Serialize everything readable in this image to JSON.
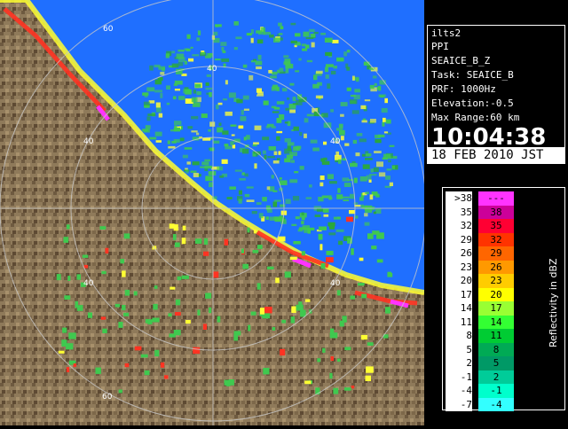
{
  "radar": {
    "range_labels": [
      "60",
      "40",
      "40",
      "40",
      "40",
      "40",
      "60"
    ],
    "colors": {
      "sea": "#1f6fff",
      "land": "#8f7a5a",
      "land_dark": "#5e4a33",
      "echo_weak": "#3fc94f",
      "echo_mid": "#2aa83a",
      "echo_strong": "#ffff33",
      "echo_heavy": "#ff3322",
      "echo_max": "#ff33ff"
    }
  },
  "info": {
    "station": "ilts2",
    "product": "PPI",
    "product_name": "SEAICE_B_Z",
    "task": "Task: SEAICE_B",
    "prf": "PRF: 1000Hz",
    "elevation": "Elevation:-0.5",
    "max_range": "Max Range:60 km",
    "time": "10:04:38",
    "date": "18 FEB 2010 JST"
  },
  "legend": {
    "title": "Reflectivity in dBZ",
    "rows": [
      {
        "label": ">38",
        "value": "---",
        "color": "#ff33ff"
      },
      {
        "label": "35",
        "value": "38",
        "color": "#cc0099"
      },
      {
        "label": "32",
        "value": "35",
        "color": "#ff0033"
      },
      {
        "label": "29",
        "value": "32",
        "color": "#ff3300"
      },
      {
        "label": "26",
        "value": "29",
        "color": "#ff6600"
      },
      {
        "label": "23",
        "value": "26",
        "color": "#ff9900"
      },
      {
        "label": "20",
        "value": "23",
        "color": "#ffcc00"
      },
      {
        "label": "17",
        "value": "20",
        "color": "#ffff00"
      },
      {
        "label": "14",
        "value": "17",
        "color": "#99ff33"
      },
      {
        "label": "11",
        "value": "14",
        "color": "#33ff33"
      },
      {
        "label": "8",
        "value": "11",
        "color": "#00cc33"
      },
      {
        "label": "5",
        "value": "8",
        "color": "#00aa55"
      },
      {
        "label": "2",
        "value": "5",
        "color": "#009966"
      },
      {
        "label": "-1",
        "value": "2",
        "color": "#00cc99"
      },
      {
        "label": "-4",
        "value": "-1",
        "color": "#00ffcc"
      },
      {
        "label": "-7",
        "value": "-4",
        "color": "#33ffff"
      }
    ]
  }
}
